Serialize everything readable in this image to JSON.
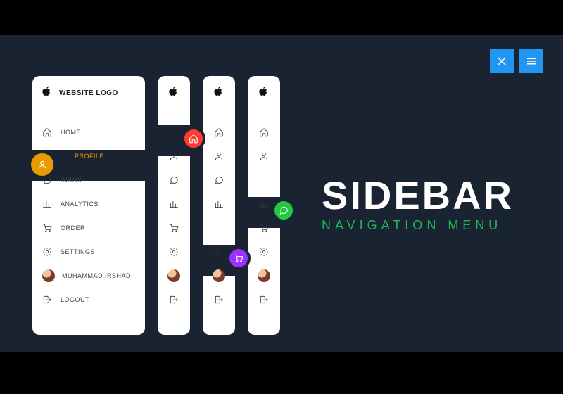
{
  "brand": {
    "logo_text": "WEBSITE LOGO"
  },
  "hero": {
    "title": "SIDEBAR",
    "subtitle": "NAVIGATION MENU"
  },
  "colors": {
    "bg": "#1a2332",
    "accent_blue": "#2196f3",
    "accent_green": "#1db954",
    "bubble_1": "#e69b00",
    "bubble_2": "#ff3b30",
    "bubble_3": "#9b30ff",
    "bubble_4": "#22c93e"
  },
  "user": {
    "name": "MUHAMMAD IRSHAD"
  },
  "nav": {
    "items": [
      {
        "icon": "home-icon",
        "label": "HOME"
      },
      {
        "icon": "user-icon",
        "label": "PROFILE"
      },
      {
        "icon": "chat-icon",
        "label": "INBOX"
      },
      {
        "icon": "analytics-icon",
        "label": "ANALYTICS"
      },
      {
        "icon": "cart-icon",
        "label": "ORDER"
      },
      {
        "icon": "gear-icon",
        "label": "SETTINGS"
      }
    ],
    "logout_label": "LOGOUT"
  },
  "active": {
    "sb1": 1,
    "sb2": 0,
    "sb3": 4,
    "sb4": 2
  }
}
